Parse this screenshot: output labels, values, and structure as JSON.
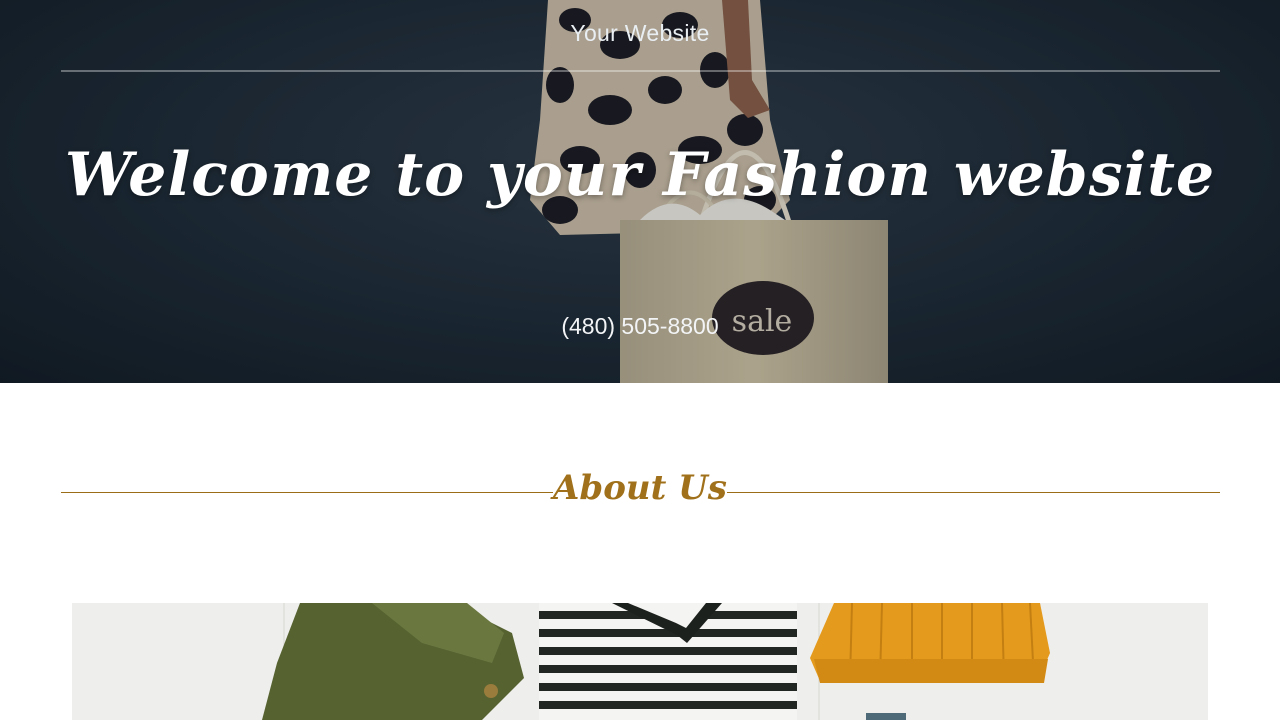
{
  "header": {
    "site_name": "Your Website"
  },
  "hero": {
    "title": "Welcome to your Fashion website",
    "phone": "(480) 505-8800",
    "bag_label": "sale"
  },
  "about": {
    "heading": "About Us"
  },
  "colors": {
    "accent": "#a0711a",
    "hero_background": "#1d2a35",
    "header_text": "#e9eef2"
  }
}
